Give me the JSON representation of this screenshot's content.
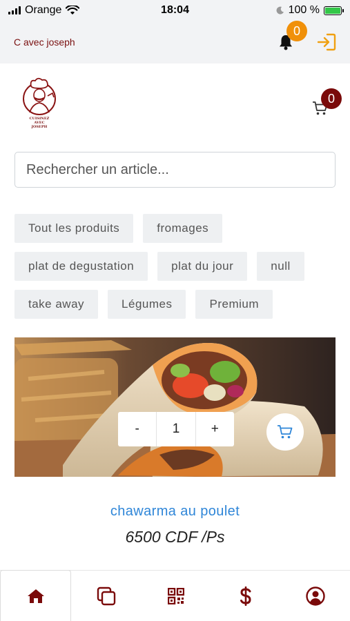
{
  "status_bar": {
    "carrier": "Orange",
    "time": "18:04",
    "battery": "100 %",
    "battery_level": 1.0
  },
  "header": {
    "brand": "C avec joseph",
    "notification_count": "0"
  },
  "logo": {
    "line1": "CUISINEZ",
    "line2": "AVEC",
    "line3": "JOSEPH"
  },
  "cart": {
    "count": "0"
  },
  "search": {
    "placeholder": "Rechercher un article..."
  },
  "categories": [
    "Tout les produits",
    "fromages",
    "plat de degustation",
    "plat du jour",
    "null",
    "take away",
    "Légumes",
    "Premium"
  ],
  "product": {
    "name": "chawarma au poulet",
    "price": "6500 CDF /Ps",
    "qty_minus": "-",
    "quantity": "1",
    "qty_plus": "+"
  },
  "nav": {
    "items": [
      "home-icon",
      "copy-icon",
      "qr-code-icon",
      "dollar-icon",
      "user-circle-icon"
    ],
    "active_index": 0
  },
  "colors": {
    "brand": "#7a1010",
    "accent_blue": "#2f86d8",
    "badge_orange": "#f0900a",
    "badge_red": "#7a0a0a"
  }
}
